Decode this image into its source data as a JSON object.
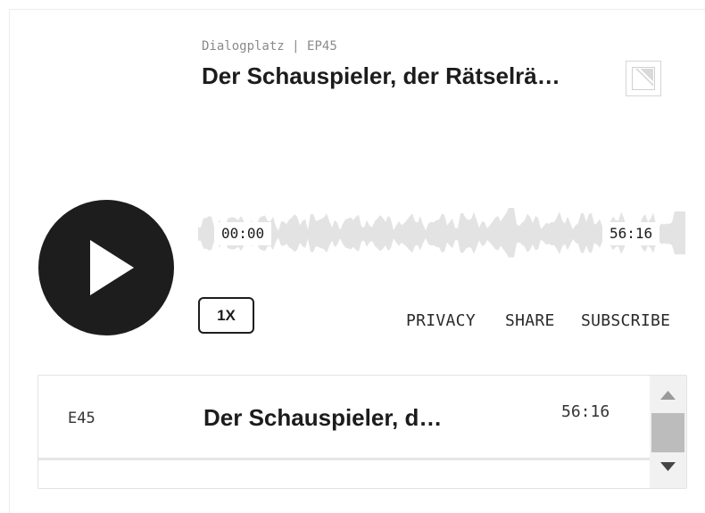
{
  "header": {
    "show_name": "Dialogplatz",
    "separator": "|",
    "episode_code": "EP45",
    "episode_title": "Der Schauspieler, der Rätselrä…"
  },
  "cover": {
    "icon": "no-image-icon"
  },
  "player": {
    "play_icon": "play-icon",
    "current_time": "00:00",
    "duration": "56:16",
    "progress": 0,
    "speed_label": "1X",
    "waveform_color": "#e3e3e3"
  },
  "links": {
    "privacy": "PRIVACY",
    "share": "SHARE",
    "subscribe": "SUBSCRIBE"
  },
  "playlist": {
    "items": [
      {
        "number": "E45",
        "title": "Der Schauspieler, d…",
        "duration": "56:16"
      }
    ],
    "scroll_up_icon": "triangle-up-icon",
    "scroll_down_icon": "triangle-down-icon"
  },
  "colors": {
    "button_dark": "#1d1d1d",
    "text_muted": "#8a8a8a",
    "scrollbar_thumb": "#bcbcbc"
  }
}
